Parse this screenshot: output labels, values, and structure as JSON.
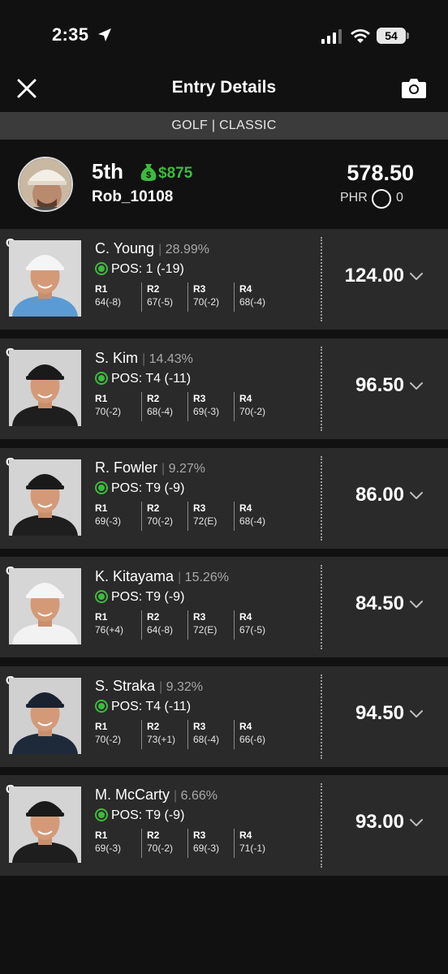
{
  "status_bar": {
    "time": "2:35",
    "battery": "54"
  },
  "header": {
    "title": "Entry Details"
  },
  "sport_bar": {
    "label": "GOLF | CLASSIC"
  },
  "entry": {
    "rank": "5th",
    "winnings": "$875",
    "username": "Rob_10108",
    "total_points": "578.50",
    "phr_label": "PHR",
    "phr_value": "0"
  },
  "colors": {
    "accent_green": "#3dbb3d",
    "card_bg": "#2a2a2a",
    "page_bg": "#111111",
    "sport_bar_bg": "#3b3b3b"
  },
  "players": [
    {
      "position": "G",
      "name": "C. Young",
      "ownership": "28.99%",
      "pos_status": "POS: 1 (-19)",
      "rounds": [
        {
          "label": "R1",
          "score": "64(-8)"
        },
        {
          "label": "R2",
          "score": "67(-5)"
        },
        {
          "label": "R3",
          "score": "70(-2)"
        },
        {
          "label": "R4",
          "score": "68(-4)"
        }
      ],
      "fpts": "124.00"
    },
    {
      "position": "G",
      "name": "S. Kim",
      "ownership": "14.43%",
      "pos_status": "POS: T4 (-11)",
      "rounds": [
        {
          "label": "R1",
          "score": "70(-2)"
        },
        {
          "label": "R2",
          "score": "68(-4)"
        },
        {
          "label": "R3",
          "score": "69(-3)"
        },
        {
          "label": "R4",
          "score": "70(-2)"
        }
      ],
      "fpts": "96.50"
    },
    {
      "position": "G",
      "name": "R. Fowler",
      "ownership": "9.27%",
      "pos_status": "POS: T9 (-9)",
      "rounds": [
        {
          "label": "R1",
          "score": "69(-3)"
        },
        {
          "label": "R2",
          "score": "70(-2)"
        },
        {
          "label": "R3",
          "score": "72(E)"
        },
        {
          "label": "R4",
          "score": "68(-4)"
        }
      ],
      "fpts": "86.00"
    },
    {
      "position": "G",
      "name": "K. Kitayama",
      "ownership": "15.26%",
      "pos_status": "POS: T9 (-9)",
      "rounds": [
        {
          "label": "R1",
          "score": "76(+4)"
        },
        {
          "label": "R2",
          "score": "64(-8)"
        },
        {
          "label": "R3",
          "score": "72(E)"
        },
        {
          "label": "R4",
          "score": "67(-5)"
        }
      ],
      "fpts": "84.50"
    },
    {
      "position": "G",
      "name": "S. Straka",
      "ownership": "9.32%",
      "pos_status": "POS: T4 (-11)",
      "rounds": [
        {
          "label": "R1",
          "score": "70(-2)"
        },
        {
          "label": "R2",
          "score": "73(+1)"
        },
        {
          "label": "R3",
          "score": "68(-4)"
        },
        {
          "label": "R4",
          "score": "66(-6)"
        }
      ],
      "fpts": "94.50"
    },
    {
      "position": "G",
      "name": "M. McCarty",
      "ownership": "6.66%",
      "pos_status": "POS: T9 (-9)",
      "rounds": [
        {
          "label": "R1",
          "score": "69(-3)"
        },
        {
          "label": "R2",
          "score": "70(-2)"
        },
        {
          "label": "R3",
          "score": "69(-3)"
        },
        {
          "label": "R4",
          "score": "71(-1)"
        }
      ],
      "fpts": "93.00"
    }
  ]
}
